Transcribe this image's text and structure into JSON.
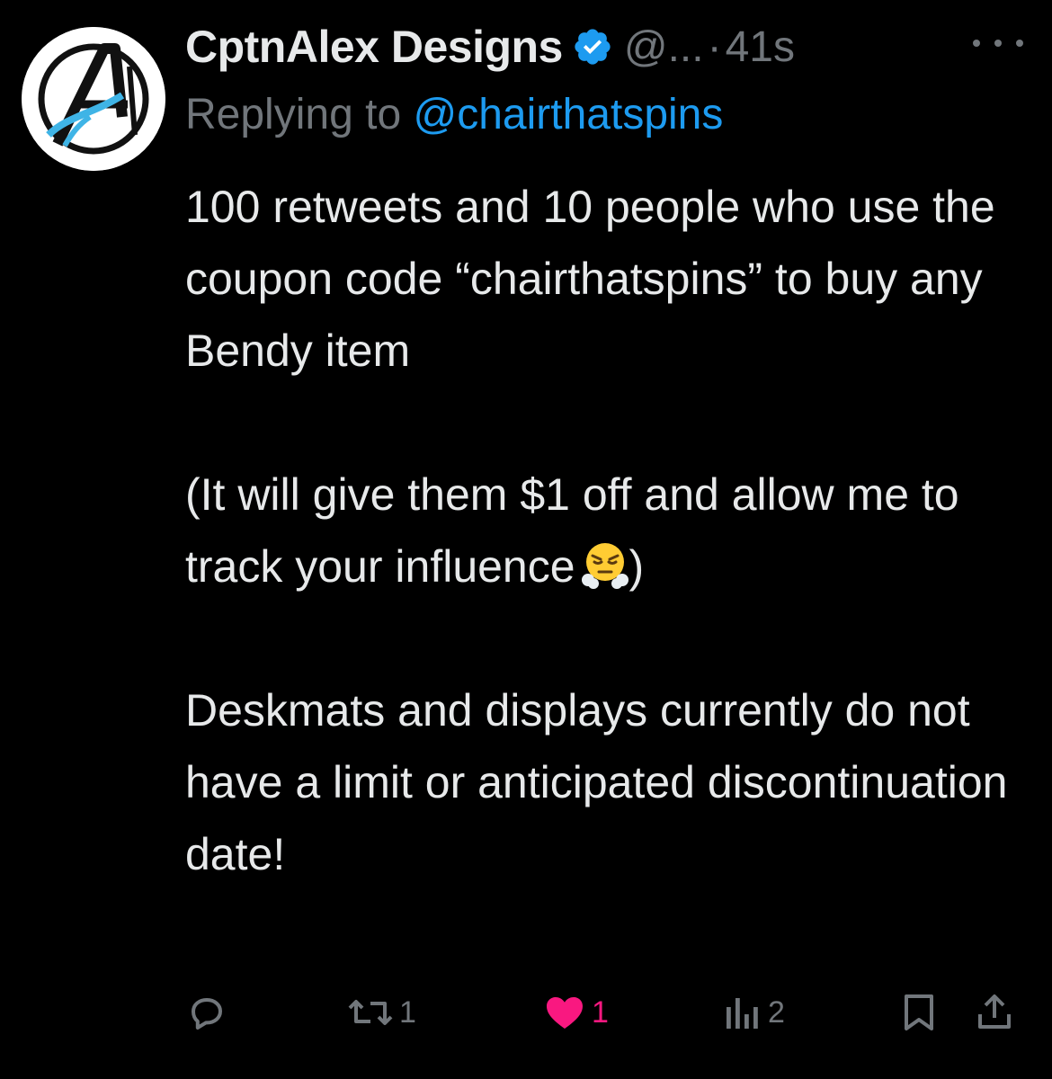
{
  "tweet": {
    "author_name": "CptnAlex Designs",
    "handle": "@...",
    "separator": "·",
    "time": "41s",
    "replying_prefix": "Replying to",
    "replying_to": "@chairthatspins",
    "lines": [
      "100 retweets and 10 people who use the coupon code “chairthatspins” to buy any Bendy item",
      "(It will give them $1 off and allow me to track your influence",
      ")",
      "Deskmats and displays currently do not have a limit or anticipated discontinuation date!"
    ],
    "emoji": "face-with-steam-from-nose"
  },
  "actions": {
    "reply_count": "",
    "retweet_count": "1",
    "like_count": "1",
    "views_count": "2"
  },
  "colors": {
    "background": "#000000",
    "text": "#e7e9ea",
    "muted": "#71767b",
    "link": "#1d9bf0",
    "like": "#f91880",
    "verified": "#1d9bf0"
  }
}
